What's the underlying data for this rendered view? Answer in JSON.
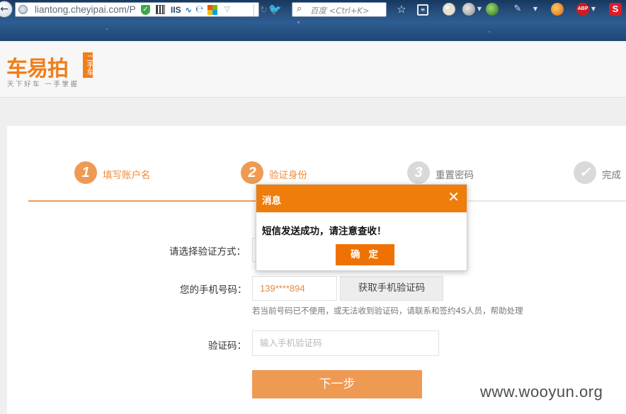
{
  "browser": {
    "url": "liantong.cheyipai.com/P",
    "search_placeholder": "百度 <Ctrl+K>",
    "extensions": {
      "iis_label": "IIS",
      "abp_label": "ABP",
      "s_label": "S"
    },
    "icons": [
      "back-icon",
      "globe-icon",
      "shield-icon",
      "qr-icon",
      "iis-icon",
      "wave-icon",
      "ie-icon",
      "windows-icon",
      "dropdown-icon",
      "reload-icon",
      "bird-icon",
      "search-icon",
      "star-icon",
      "reader-icon",
      "palette-icon",
      "addon-icon",
      "green-icon",
      "tool-icon",
      "fox-icon",
      "abp-icon",
      "s-icon"
    ]
  },
  "header": {
    "logo_text": "车易拍",
    "logo_badge": "二手车",
    "slogan": "天下好车 一手掌握"
  },
  "steps": [
    {
      "num": "1",
      "label": "填写账户名",
      "state": "done"
    },
    {
      "num": "2",
      "label": "验证身份",
      "state": "done"
    },
    {
      "num": "3",
      "label": "重置密码",
      "state": "todo"
    },
    {
      "num": "✓",
      "label": "完成",
      "state": "todo"
    }
  ],
  "progress": {
    "completed_fraction": 0.5
  },
  "form": {
    "method_label": "请选择验证方式：",
    "phone_label": "您的手机号码：",
    "phone_value": "139****894",
    "get_code_label": "获取手机验证码",
    "phone_hint": "若当前号码已不使用，或无法收到验证码，请联系和签约4S人员，帮助处理",
    "code_label": "验证码：",
    "code_placeholder": "输入手机验证码",
    "next_label": "下一步"
  },
  "dialog": {
    "title": "消息",
    "close": "✕",
    "message": "短信发送成功，请注意查收！",
    "ok_label": "确定"
  },
  "watermark": "www.wooyun.org",
  "colors": {
    "accent": "#ef9a53",
    "dialog_header": "#ef7d0b",
    "dialog_button": "#ee7203"
  }
}
